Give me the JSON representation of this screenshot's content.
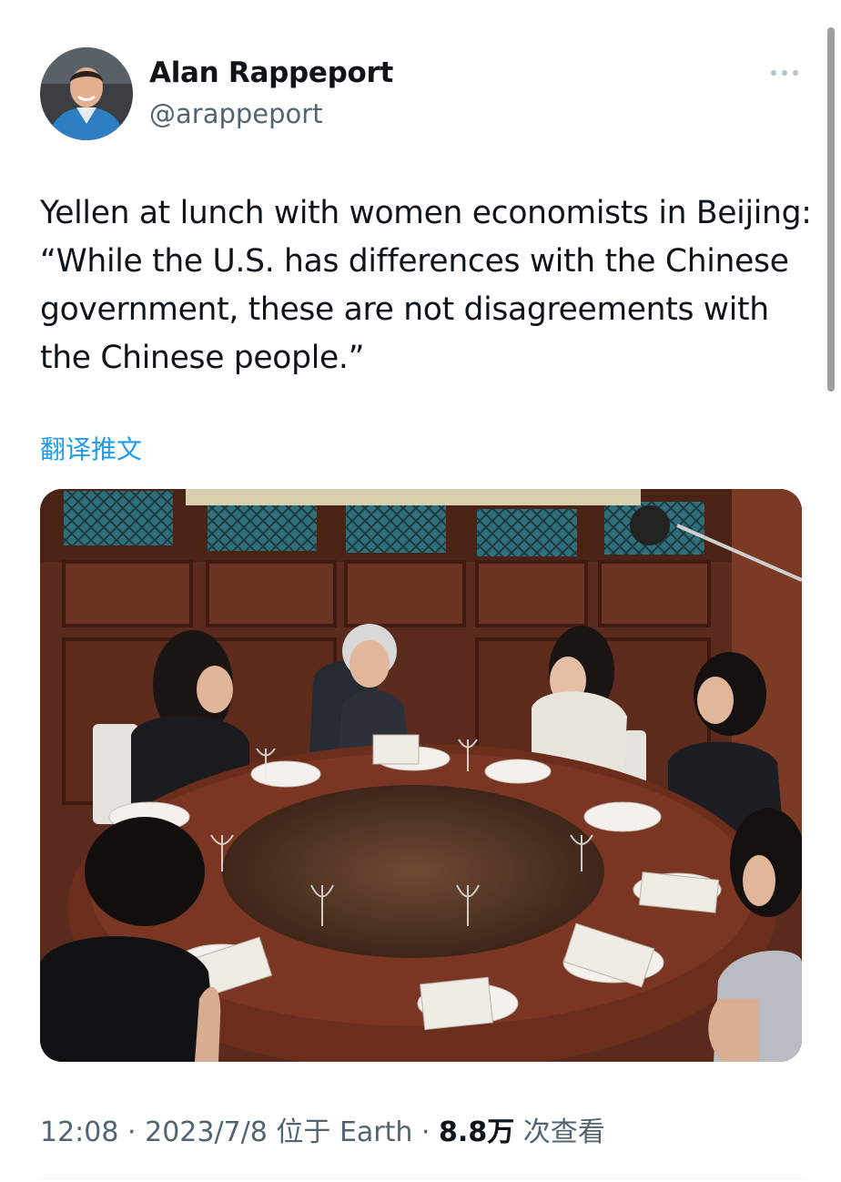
{
  "author": {
    "display_name": "Alan Rappeport",
    "handle": "@arappeport"
  },
  "tweet": {
    "text": "Yellen at lunch with women economists in Beijing: “While the U.S. has differences with the Chinese government, these are not disagreements with the Chinese people.”",
    "translate_label": "翻译推文"
  },
  "meta": {
    "time": "12:08",
    "date": "2023/7/8",
    "location_prefix": "位于",
    "location": "Earth",
    "views_count": "8.8万",
    "views_label": "次查看",
    "separator": "·"
  },
  "icons": {
    "more": "more-horizontal-icon"
  },
  "colors": {
    "text_primary": "#0f1419",
    "text_secondary": "#536471",
    "link": "#1d9bf0"
  }
}
